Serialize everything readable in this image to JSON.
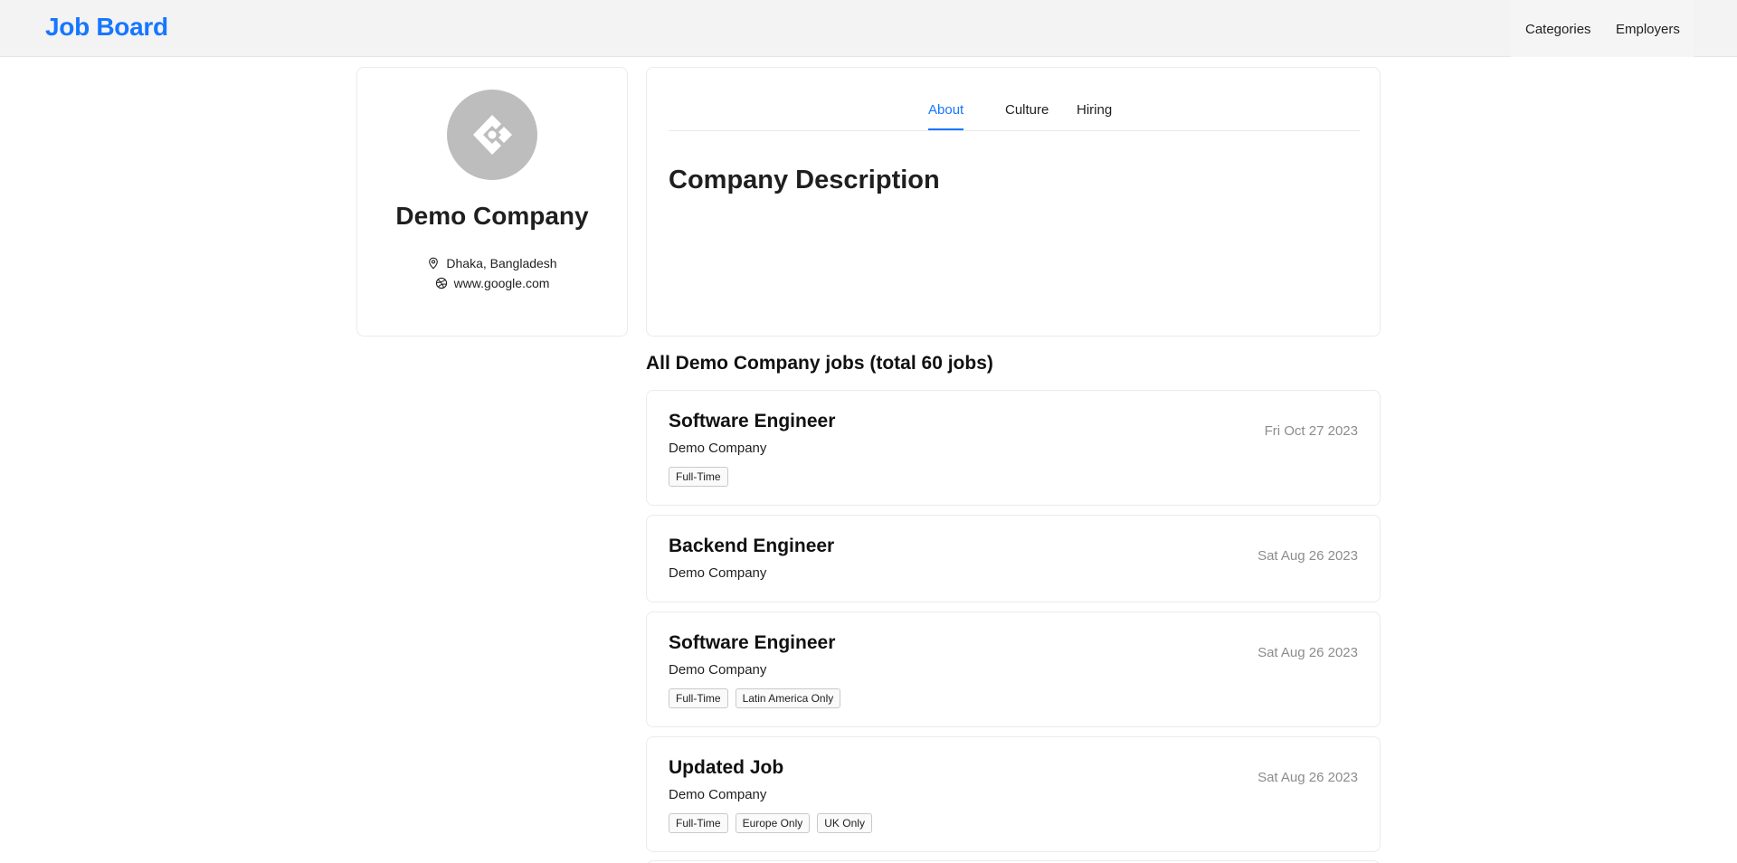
{
  "navbar": {
    "brand": "Job Board",
    "menu": [
      "Categories",
      "Employers"
    ]
  },
  "company": {
    "name": "Demo Company",
    "location": "Dhaka, Bangladesh",
    "website": "www.google.com",
    "logo_icon": "ant-design-logo-icon"
  },
  "tabs": {
    "items": [
      "About",
      "Culture",
      "Hiring"
    ],
    "active": "About"
  },
  "about": {
    "heading": "Company Description"
  },
  "jobs": {
    "heading": "All Demo Company jobs (total 60 jobs)",
    "items": [
      {
        "title": "Software Engineer",
        "company": "Demo Company",
        "date": "Fri Oct 27 2023",
        "tags": [
          "Full-Time"
        ]
      },
      {
        "title": "Backend Engineer",
        "company": "Demo Company",
        "date": "Sat Aug 26 2023",
        "tags": []
      },
      {
        "title": "Software Engineer",
        "company": "Demo Company",
        "date": "Sat Aug 26 2023",
        "tags": [
          "Full-Time",
          "Latin America Only"
        ]
      },
      {
        "title": "Updated Job",
        "company": "Demo Company",
        "date": "Sat Aug 26 2023",
        "tags": [
          "Full-Time",
          "Europe Only",
          "UK Only"
        ]
      }
    ]
  },
  "colors": {
    "accent": "#1677ff",
    "navbar_bg": "#f3f3f3",
    "logo_bg": "#bdbdbd",
    "date_text": "#8c8c8c"
  }
}
